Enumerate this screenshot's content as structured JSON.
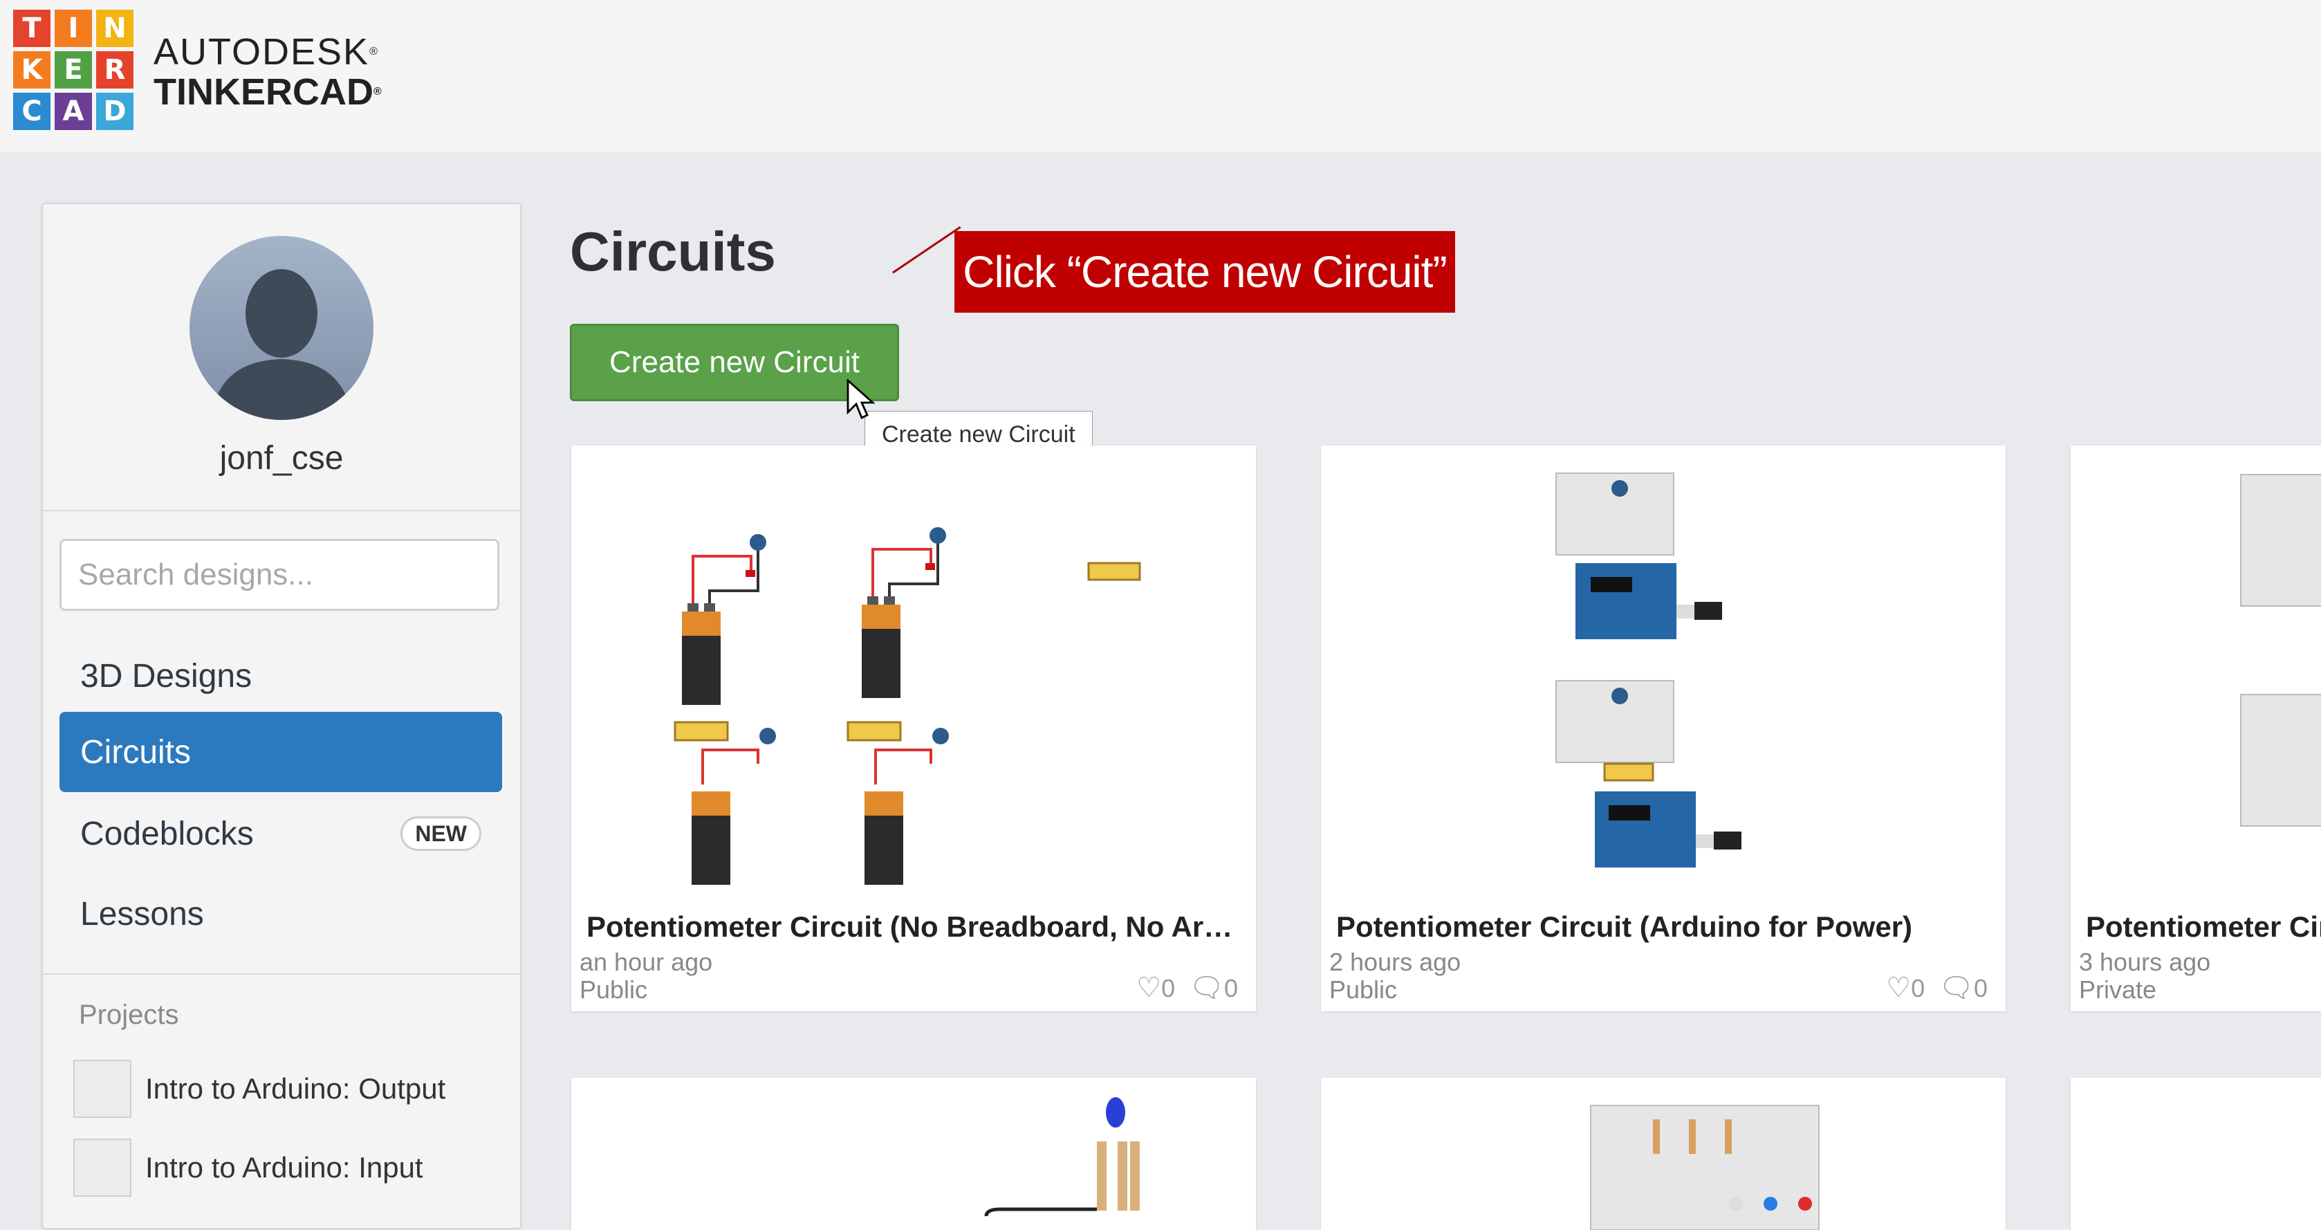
{
  "brand": {
    "logo_letters": [
      "T",
      "I",
      "N",
      "K",
      "E",
      "R",
      "C",
      "A",
      "D"
    ],
    "logo_colors": [
      "#e5432d",
      "#f47c20",
      "#f3b413",
      "#f47c20",
      "#51a144",
      "#e5432d",
      "#2c8ad1",
      "#6b3f96",
      "#3aa6d9"
    ],
    "line1": "AUTODESK",
    "line2": "TINKERCAD",
    "reg": "®"
  },
  "sidebar": {
    "username": "jonf_cse",
    "search_placeholder": "Search designs...",
    "nav": [
      {
        "label": "3D Designs",
        "active": false
      },
      {
        "label": "Circuits",
        "active": true
      },
      {
        "label": "Codeblocks",
        "active": false,
        "badge": "NEW"
      },
      {
        "label": "Lessons",
        "active": false
      }
    ],
    "projects_heading": "Projects",
    "projects": [
      "Intro to Arduino: Output",
      "Intro to Arduino: Input"
    ]
  },
  "main": {
    "heading": "Circuits",
    "create_button": "Create new Circuit",
    "tooltip": "Create new Circuit",
    "callout": "Click “Create new Circuit”"
  },
  "cards": [
    {
      "title": "Potentiometer Circuit (No Breadboard, No Ardu...",
      "time": "an hour ago",
      "visibility": "Public",
      "likes": "0",
      "comments": "0"
    },
    {
      "title": "Potentiometer Circuit (Arduino for Power)",
      "time": "2 hours ago",
      "visibility": "Public",
      "likes": "0",
      "comments": "0"
    },
    {
      "title": "Potentiometer Circ",
      "time": "3 hours ago",
      "visibility": "Private",
      "likes": "",
      "comments": ""
    },
    {
      "title": "",
      "time": "",
      "visibility": "",
      "likes": "",
      "comments": ""
    },
    {
      "title": "",
      "time": "",
      "visibility": "",
      "likes": "",
      "comments": ""
    },
    {
      "title": "",
      "time": "",
      "visibility": "",
      "likes": "",
      "comments": ""
    }
  ],
  "icons": {
    "heart": "heart-icon",
    "comment": "comment-icon"
  }
}
